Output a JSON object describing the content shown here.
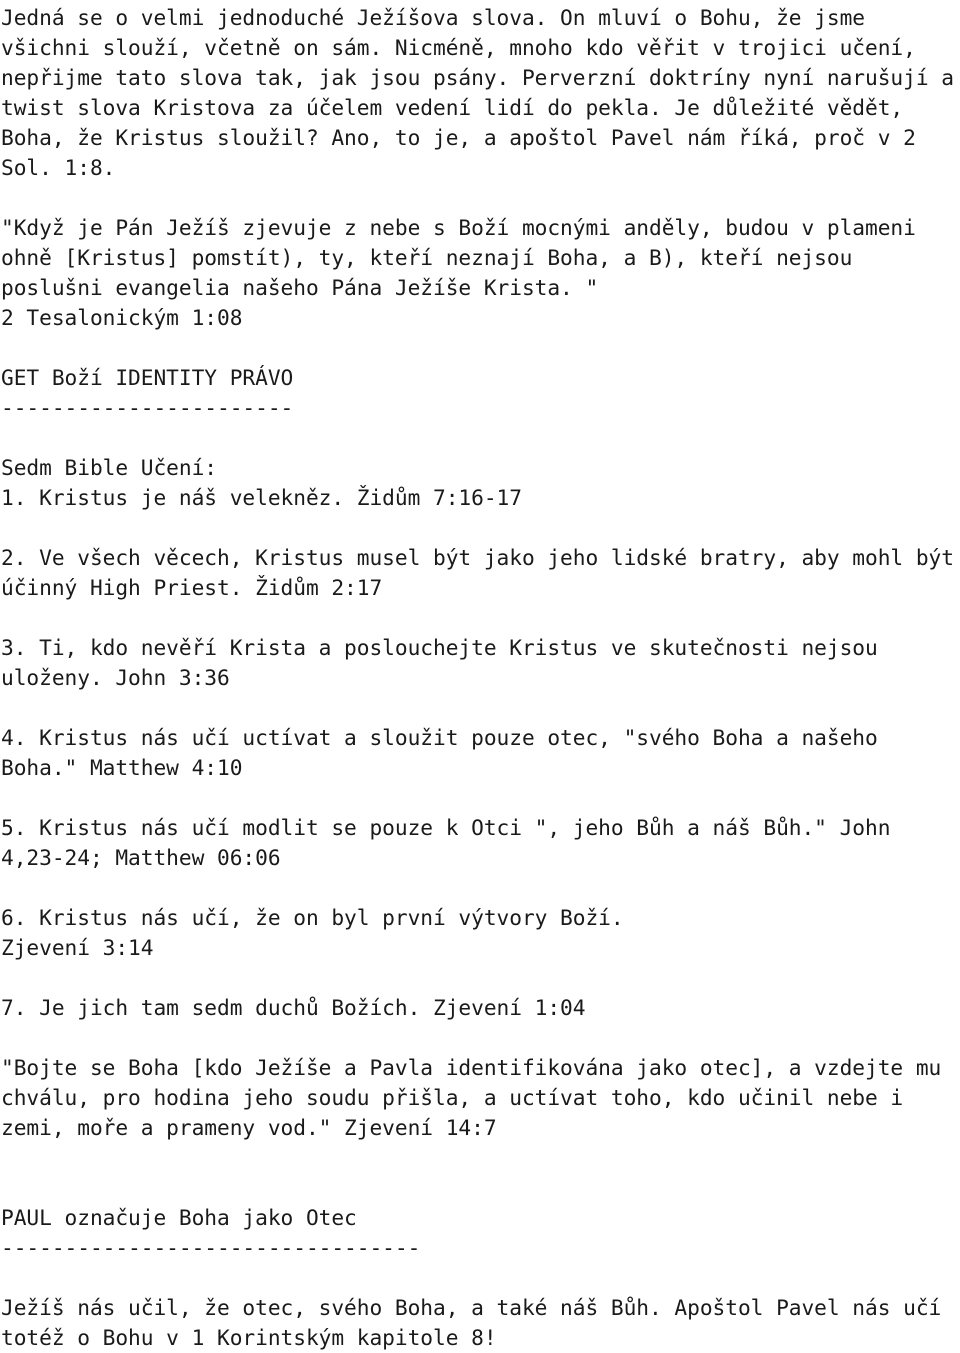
{
  "document": {
    "language": "cs",
    "background_color": "#ffffff",
    "text_color": "#1a1a1a",
    "lines": [
      "Jedná se o velmi jednoduché Ježíšova slova. On mluví o Bohu, že jsme",
      "všichni slouží, včetně on sám. Nicméně, mnoho kdo věřit v trojici učení,",
      "nepřijme tato slova tak, jak jsou psány. Perverzní doktríny nyní narušují a",
      "twist slova Kristova za účelem vedení lidí do pekla. Je důležité vědět,",
      "Boha, že Kristus sloužil? Ano, to je, a apoštol Pavel nám říká, proč v 2",
      "Sol. 1:8.",
      "",
      "\"Když je Pán Ježíš zjevuje z nebe s Boží mocnými anděly, budou v plameni",
      "ohně [Kristus] pomstít), ty, kteří neznají Boha, a B), kteří nejsou",
      "poslušni evangelia našeho Pána Ježíše Krista. \"",
      "2 Tesalonickým 1:08",
      "",
      "GET Boží IDENTITY PRÁVO",
      "-----------------------",
      "",
      "Sedm Bible Učení:",
      "1. Kristus je náš velekněz. Židům 7:16-17",
      "",
      "2. Ve všech věcech, Kristus musel být jako jeho lidské bratry, aby mohl být",
      "účinný High Priest. Židům 2:17",
      "",
      "3. Ti, kdo nevěří Krista a poslouchejte Kristus ve skutečnosti nejsou",
      "uloženy. John 3:36",
      "",
      "4. Kristus nás učí uctívat a sloužit pouze otec, \"svého Boha a našeho",
      "Boha.\" Matthew 4:10",
      "",
      "5. Kristus nás učí modlit se pouze k Otci \", jeho Bůh a náš Bůh.\" John",
      "4,23-24; Matthew 06:06",
      "",
      "6. Kristus nás učí, že on byl první výtvory Boží.",
      "Zjevení 3:14",
      "",
      "7. Je jich tam sedm duchů Božích. Zjevení 1:04",
      "",
      "\"Bojte se Boha [kdo Ježíše a Pavla identifikována jako otec], a vzdejte mu",
      "chválu, pro hodina jeho soudu přišla, a uctívat toho, kdo učinil nebe i",
      "zemi, moře a prameny vod.\" Zjevení 14:7",
      "",
      "",
      "PAUL označuje Boha jako Otec",
      "---------------------------------",
      "",
      "Ježíš nás učil, že otec, svého Boha, a také náš Bůh. Apoštol Pavel nás učí",
      "totéž o Bohu v 1 Korintským kapitole 8!"
    ]
  }
}
